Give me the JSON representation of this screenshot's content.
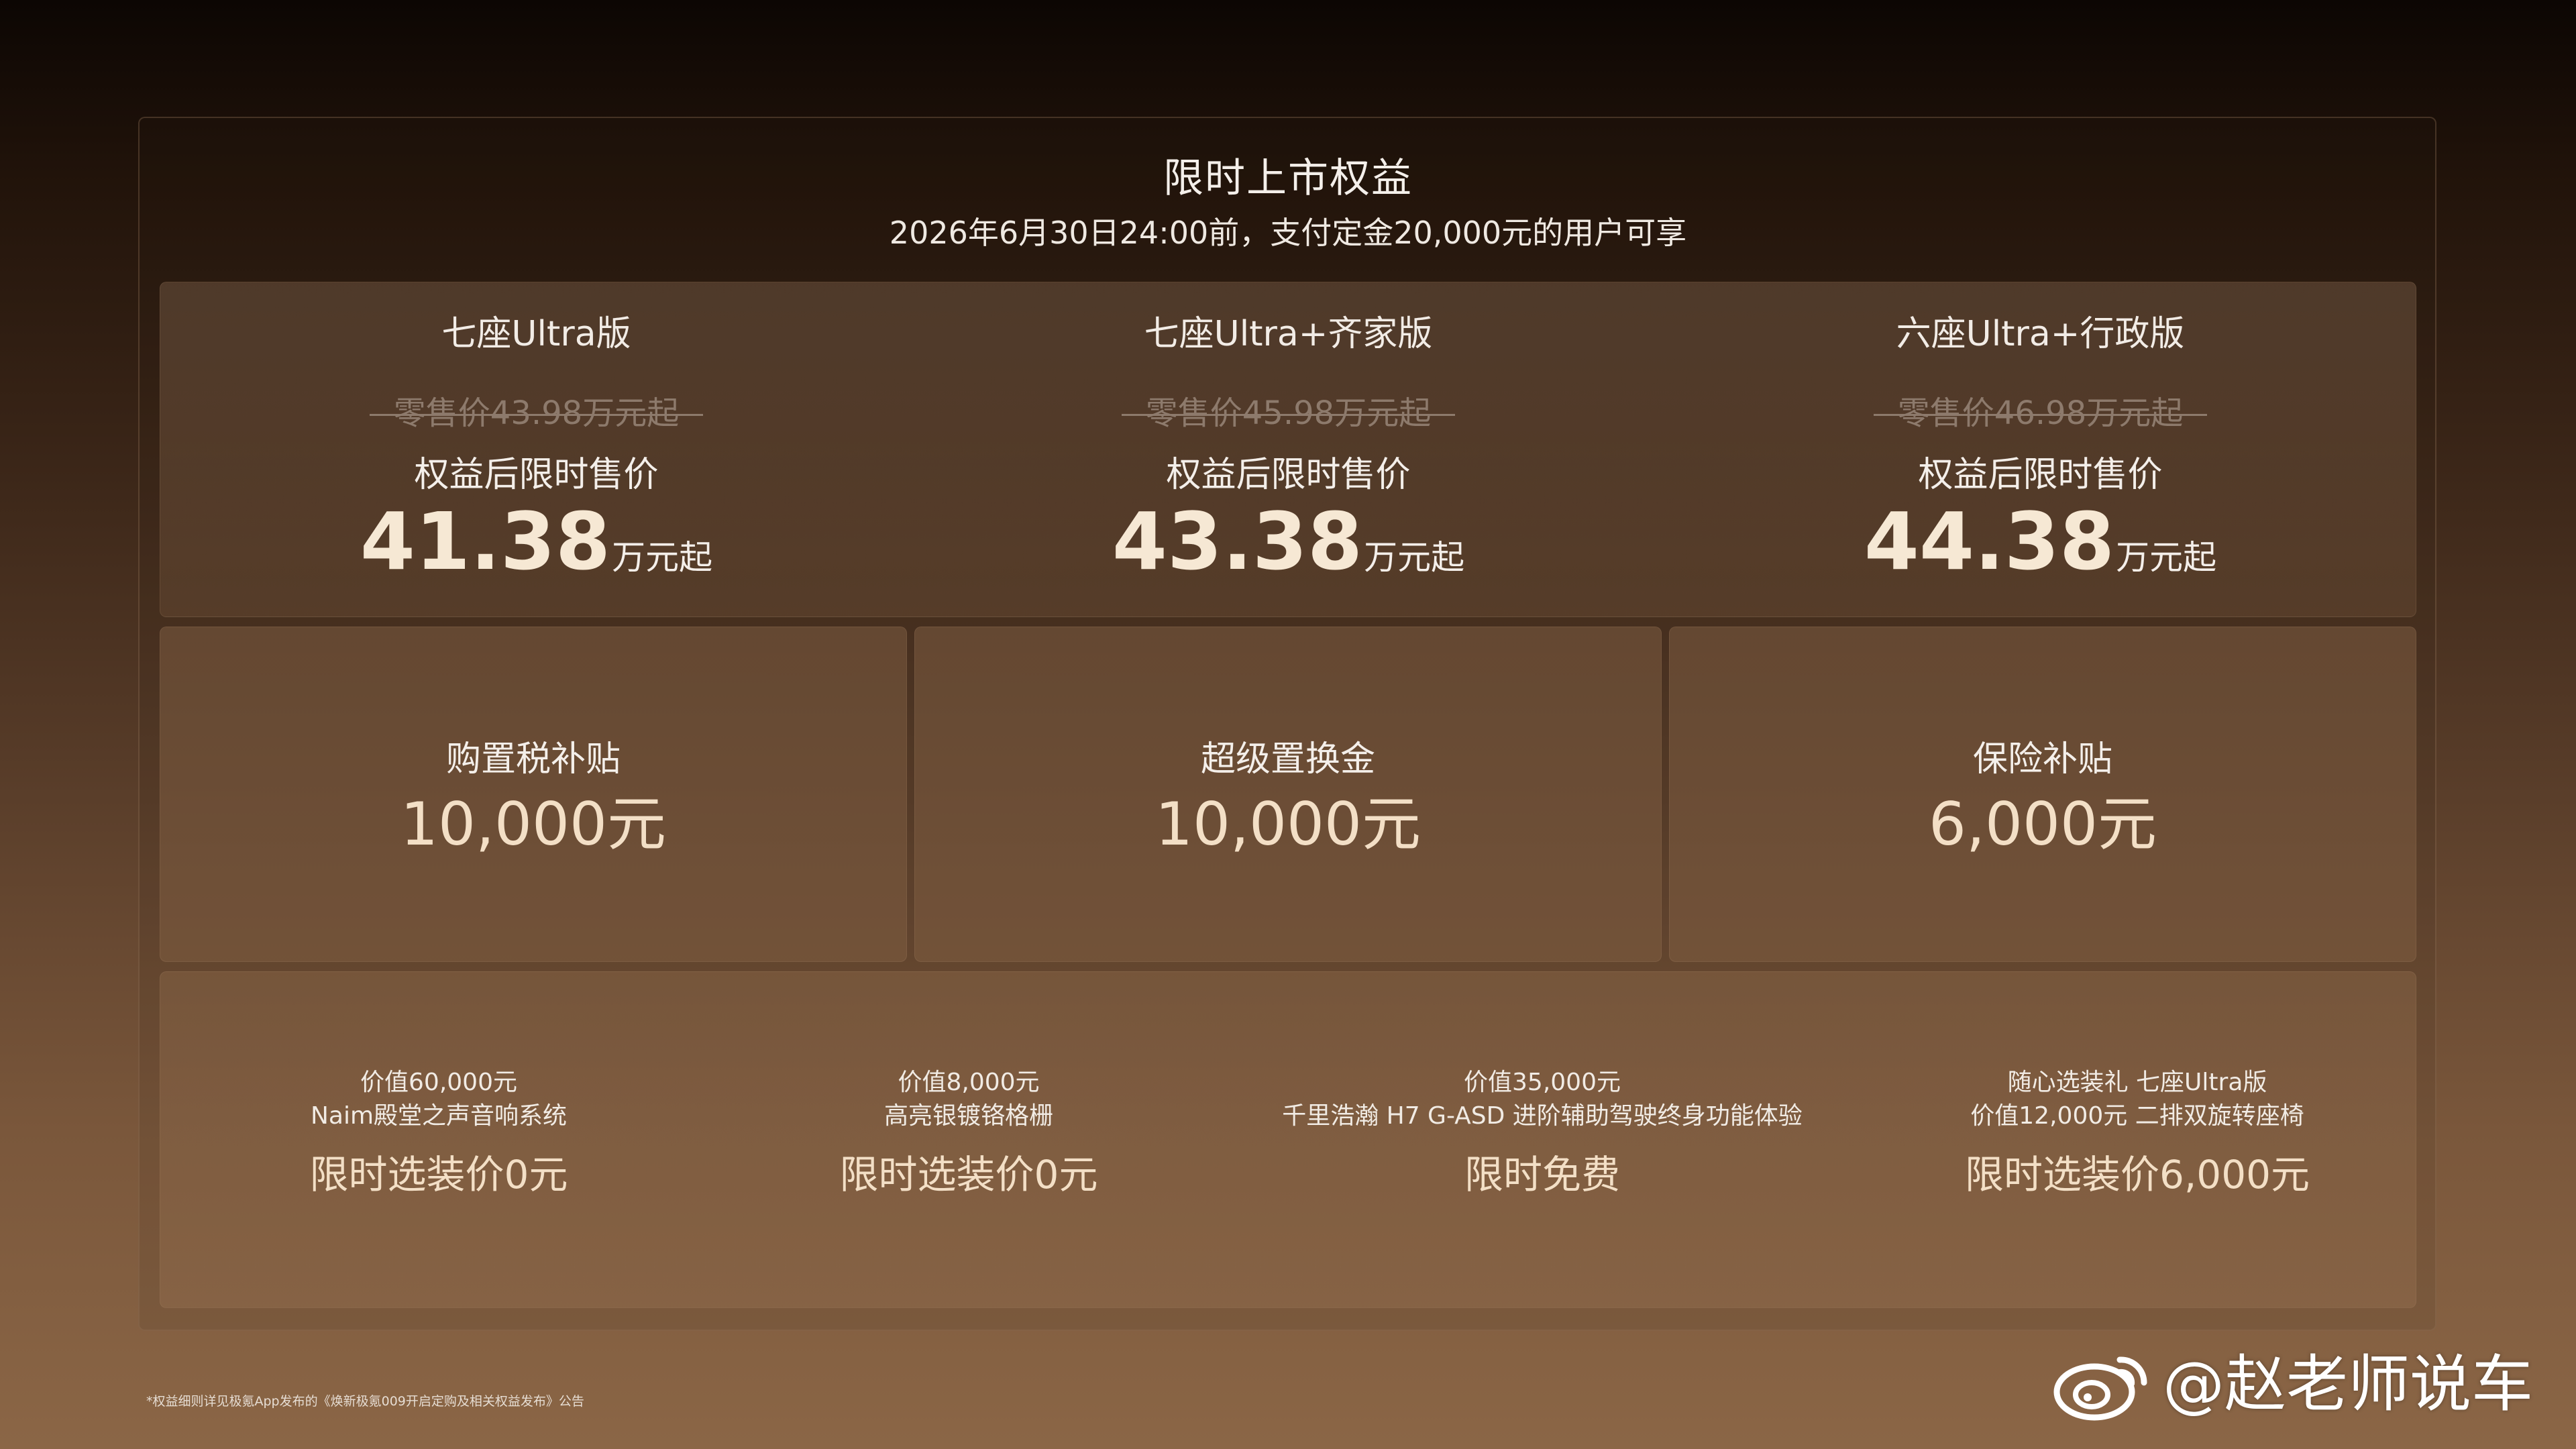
{
  "header": {
    "title": "限时上市权益",
    "subtitle": "2026年6月30日24:00前，支付定金20,000元的用户可享"
  },
  "models": [
    {
      "name": "七座Ultra版",
      "retail": "零售价43.98万元起",
      "after_label": "权益后限时售价",
      "price": "41.38",
      "unit": "万元起"
    },
    {
      "name": "七座Ultra+齐家版",
      "retail": "零售价45.98万元起",
      "after_label": "权益后限时售价",
      "price": "43.38",
      "unit": "万元起"
    },
    {
      "name": "六座Ultra+行政版",
      "retail": "零售价46.98万元起",
      "after_label": "权益后限时售价",
      "price": "44.38",
      "unit": "万元起"
    }
  ],
  "subsidies": [
    {
      "label": "购置税补贴",
      "value": "10,000元"
    },
    {
      "label": "超级置换金",
      "value": "10,000元"
    },
    {
      "label": "保险补贴",
      "value": "6,000元"
    }
  ],
  "options": [
    {
      "line1": "价值60,000元",
      "line2": "Naim殿堂之声音响系统",
      "price": "限时选装价0元"
    },
    {
      "line1": "价值8,000元",
      "line2": "高亮银镀铬格栅",
      "price": "限时选装价0元"
    },
    {
      "line1": "价值35,000元",
      "line2": "千里浩瀚 H7 G-ASD 进阶辅助驾驶终身功能体验",
      "price": "限时免费"
    },
    {
      "line1": "随心选装礼 七座Ultra版",
      "line2": "价值12,000元 二排双旋转座椅",
      "price": "限时选装价6,000元"
    }
  ],
  "footnote": "*权益细则详见极氪App发布的《焕新极氪009开启定购及相关权益发布》公告",
  "watermark": {
    "text": "@赵老师说车",
    "icon": "weibo-icon"
  },
  "colors": {
    "accent_gold": "#f3dfc6",
    "strike_gray": "#8d7a6c"
  }
}
